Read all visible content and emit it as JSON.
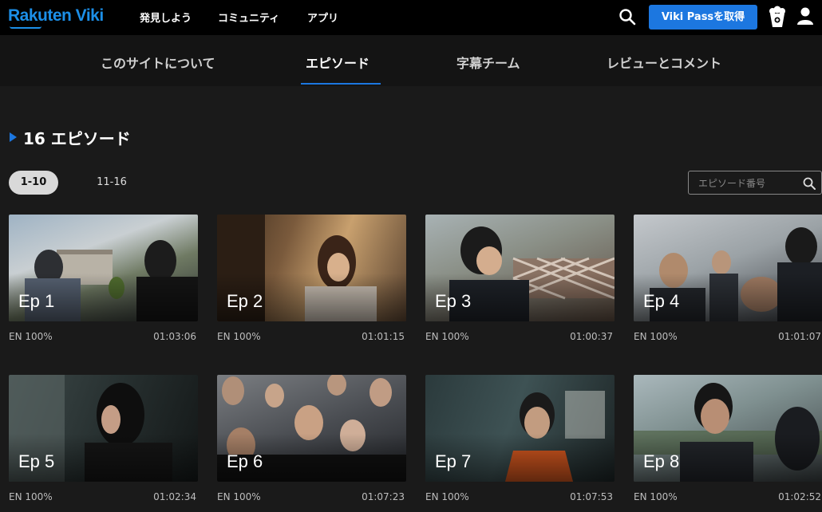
{
  "brand": {
    "logo_text": "Rakuten Viki",
    "color": "#1c8fe8"
  },
  "topnav": {
    "items": [
      "発見しよう",
      "コミュニティ",
      "アプリ"
    ]
  },
  "header": {
    "pass_button": "Viki Passを取得"
  },
  "tabs": [
    "このサイトについて",
    "エピソード",
    "字幕チーム",
    "レビューとコメント"
  ],
  "active_tab": "エピソード",
  "section": {
    "title": "16 エピソード"
  },
  "ranges": [
    "1-10",
    "11-16"
  ],
  "episode_search": {
    "placeholder": "エピソード番号"
  },
  "episodes": [
    {
      "label": "Ep 1",
      "lang": "EN 100%",
      "duration": "01:03:06"
    },
    {
      "label": "Ep 2",
      "lang": "EN 100%",
      "duration": "01:01:15"
    },
    {
      "label": "Ep 3",
      "lang": "EN 100%",
      "duration": "01:00:37"
    },
    {
      "label": "Ep 4",
      "lang": "EN 100%",
      "duration": "01:01:07"
    },
    {
      "label": "Ep 5",
      "lang": "EN 100%",
      "duration": "01:02:34"
    },
    {
      "label": "Ep 6",
      "lang": "EN 100%",
      "duration": "01:07:23"
    },
    {
      "label": "Ep 7",
      "lang": "EN 100%",
      "duration": "01:07:53"
    },
    {
      "label": "Ep 8",
      "lang": "EN 100%",
      "duration": "01:02:52"
    }
  ],
  "colors": {
    "accent": "#1c77e0",
    "background": "#1a1a1a"
  }
}
